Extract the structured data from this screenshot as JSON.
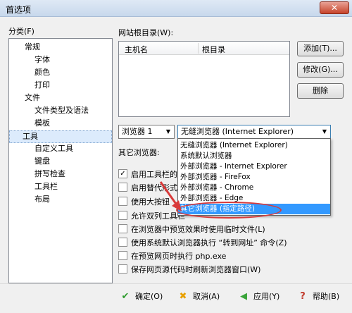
{
  "window": {
    "title": "首选项",
    "close_label": "✕"
  },
  "category": {
    "label": "分类(F)",
    "items": [
      {
        "label": "常规",
        "level": 0
      },
      {
        "label": "字体",
        "level": 1
      },
      {
        "label": "颜色",
        "level": 1
      },
      {
        "label": "打印",
        "level": 1
      },
      {
        "label": "文件",
        "level": 0
      },
      {
        "label": "文件类型及语法",
        "level": 1
      },
      {
        "label": "模板",
        "level": 1
      },
      {
        "label": "工具",
        "level": 0,
        "selected": true
      },
      {
        "label": "自定义工具",
        "level": 1
      },
      {
        "label": "键盘",
        "level": 1
      },
      {
        "label": "拼写检查",
        "level": 1
      },
      {
        "label": "工具栏",
        "level": 1
      },
      {
        "label": "布局",
        "level": 1
      }
    ]
  },
  "site_root": {
    "label": "网站根目录(W):",
    "columns": [
      "主机名",
      "根目录"
    ]
  },
  "side_buttons": {
    "add": "添加(T)...",
    "modify": "修改(G)...",
    "delete": "删除"
  },
  "browser": {
    "slot": "浏览器 1",
    "selected": "无缝浏览器 (Internet Explorer)",
    "other_label": "其它浏览器:",
    "options": [
      "无缝浏览器 (Internet Explorer)",
      "系统默认浏览器",
      "外部浏览器 - Internet Explorer",
      "外部浏览器 - FireFox",
      "外部浏览器 - Chrome",
      "外部浏览器 - Edge",
      "其它浏览器 (指定路径)"
    ],
    "highlighted_index": 6
  },
  "checkboxes": [
    {
      "label": "启用工具栏的模",
      "checked": true
    },
    {
      "label": "启用替代形式的",
      "checked": false
    },
    {
      "label": "使用大按钮",
      "checked": false
    },
    {
      "label": "允许双列工具栏",
      "checked": false
    },
    {
      "label": "在浏览器中预览效果时使用临时文件(L)",
      "checked": false
    },
    {
      "label": "使用系统默认浏览器执行 “转到网址” 命令(Z)",
      "checked": false
    },
    {
      "label": "在预览网页时执行 php.exe",
      "checked": false
    },
    {
      "label": "保存网页源代码时刷新浏览器窗口(W)",
      "checked": false
    }
  ],
  "footer": {
    "ok": "确定(O)",
    "cancel": "取消(A)",
    "apply": "应用(Y)",
    "help": "帮助(B)"
  },
  "colors": {
    "selection": "#3399ff",
    "ok_check": "#2e9b2e",
    "cancel_x": "#e8a000",
    "apply_arrow": "#3aa43a",
    "help_q": "#c0392b",
    "annotation": "#d93a3a"
  }
}
